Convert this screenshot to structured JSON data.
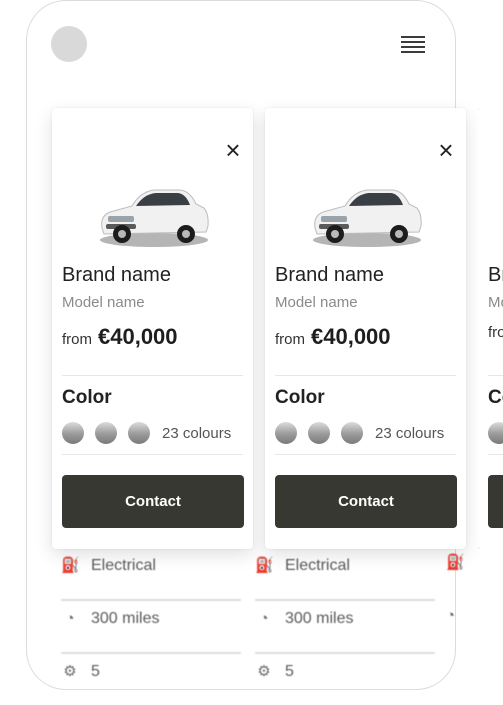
{
  "cards": [
    {
      "brand": "Brand name",
      "model": "Model name",
      "price_prefix": "from",
      "price": "€40,000",
      "color_title": "Color",
      "colours_count": "23 colours",
      "contact_label": "Contact",
      "close_icon": "close-icon"
    },
    {
      "brand": "Brand name",
      "model": "Model name",
      "price_prefix": "from",
      "price": "€40,000",
      "color_title": "Color",
      "colours_count": "23 colours",
      "contact_label": "Contact",
      "close_icon": "close-icon"
    },
    {
      "brand": "Br",
      "model": "Mo",
      "price_prefix": "fro",
      "color_title": "Co"
    }
  ],
  "specs": [
    [
      {
        "icon": "fuel-icon",
        "text": "Electrical"
      },
      {
        "icon": "speedometer-icon",
        "text": "300 miles"
      },
      {
        "icon": "gear-icon",
        "text": "5"
      }
    ],
    [
      {
        "icon": "fuel-icon",
        "text": "Electrical"
      },
      {
        "icon": "speedometer-icon",
        "text": "300 miles"
      },
      {
        "icon": "gear-icon",
        "text": "5"
      }
    ]
  ],
  "colors": {
    "button_bg": "#383833",
    "swatch": "#9a9a9a",
    "avatar": "#d9d9d9"
  }
}
